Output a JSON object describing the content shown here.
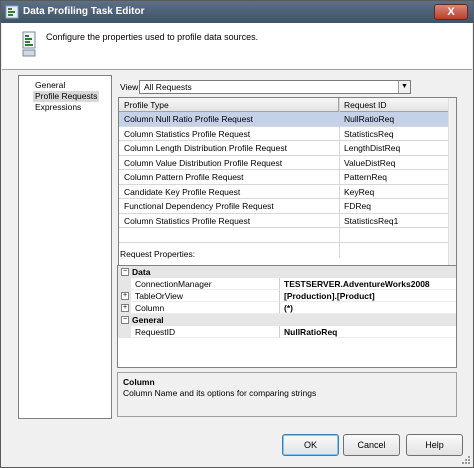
{
  "window": {
    "title": "Data Profiling Task Editor",
    "close_label": "X"
  },
  "header": {
    "description": "Configure the properties used to profile data sources."
  },
  "nav": {
    "items": [
      "General",
      "Profile Requests",
      "Expressions"
    ],
    "selected": 1
  },
  "view": {
    "label": "View",
    "value": "All Requests"
  },
  "grid": {
    "columns": [
      "Profile Type",
      "Request ID"
    ],
    "rows": [
      [
        "Column Null Ratio Profile Request",
        "NullRatioReq"
      ],
      [
        "Column Statistics Profile Request",
        "StatisticsReq"
      ],
      [
        "Column Length Distribution Profile Request",
        "LengthDistReq"
      ],
      [
        "Column Value Distribution Profile Request",
        "ValueDistReq"
      ],
      [
        "Column Pattern Profile Request",
        "PatternReq"
      ],
      [
        "Candidate Key Profile Request",
        "KeyReq"
      ],
      [
        "Functional Dependency Profile Request",
        "FDReq"
      ],
      [
        "Column Statistics Profile Request",
        "StatisticsReq1"
      ]
    ],
    "selected_row": 0
  },
  "request_properties": {
    "label": "Request Properties:",
    "categories": [
      {
        "name": "Data",
        "toggle": "−",
        "props": [
          {
            "name": "ConnectionManager",
            "value": "TESTSERVER.AdventureWorks2008",
            "expander": ""
          },
          {
            "name": "TableOrView",
            "value": "[Production].[Product]",
            "expander": "+"
          },
          {
            "name": "Column",
            "value": "(*)",
            "expander": "+"
          }
        ]
      },
      {
        "name": "General",
        "toggle": "−",
        "props": [
          {
            "name": "RequestID",
            "value": "NullRatioReq",
            "expander": ""
          }
        ]
      }
    ]
  },
  "help": {
    "title": "Column",
    "description": "Column Name and its options for comparing strings"
  },
  "buttons": {
    "ok": "OK",
    "cancel": "Cancel",
    "help": "Help"
  },
  "colors": {
    "title_bar": "#4a5e74",
    "selected_row": "#c4d1e6",
    "close_button": "#c4523e"
  }
}
